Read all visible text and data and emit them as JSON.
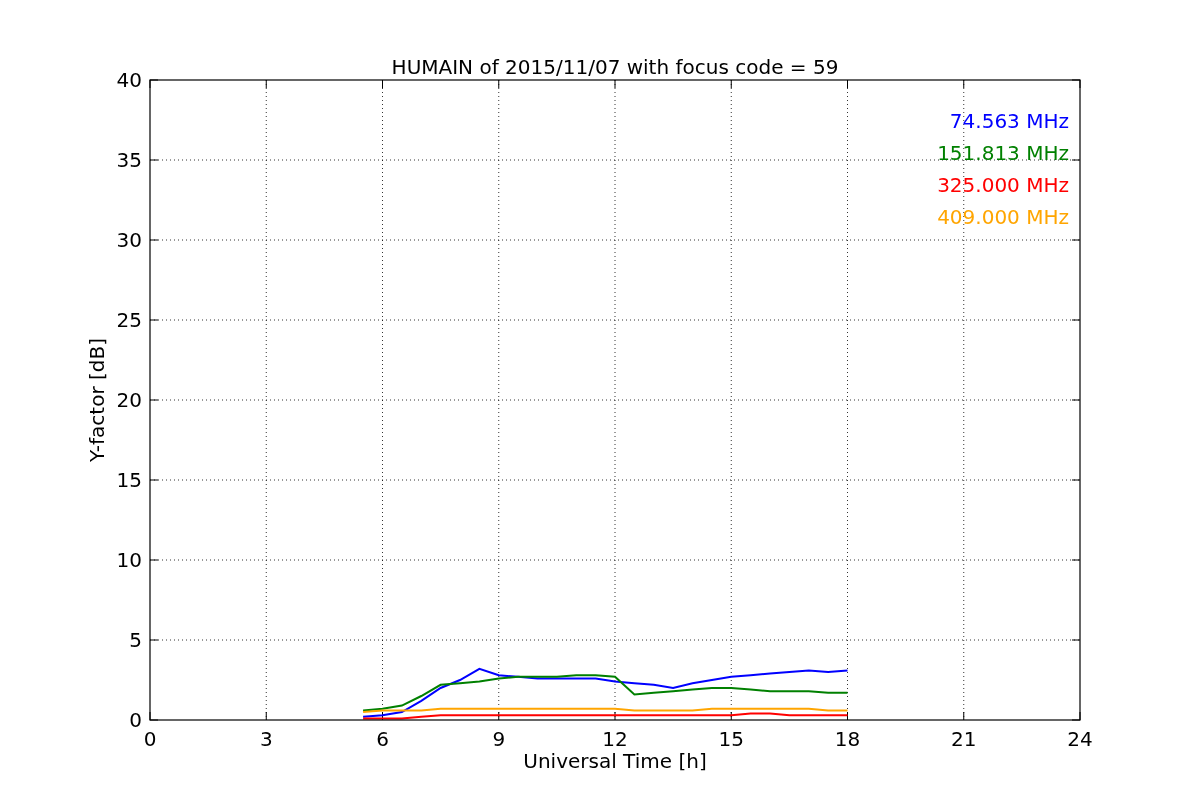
{
  "chart_data": {
    "type": "line",
    "title": "HUMAIN of 2015/11/07 with focus code = 59",
    "xlabel": "Universal Time [h]",
    "ylabel": "Y-factor [dB]",
    "x": [
      5.5,
      6,
      6.5,
      7,
      7.5,
      8,
      8.5,
      9,
      9.5,
      10,
      10.5,
      11,
      11.5,
      12,
      12.5,
      13,
      13.5,
      14,
      14.5,
      15,
      15.5,
      16,
      16.5,
      17,
      17.5,
      18
    ],
    "series": [
      {
        "name": "74.563 MHz",
        "color": "#0000ff",
        "values": [
          0.2,
          0.3,
          0.5,
          1.2,
          2.0,
          2.5,
          3.2,
          2.8,
          2.7,
          2.6,
          2.6,
          2.6,
          2.6,
          2.4,
          2.3,
          2.2,
          2.0,
          2.3,
          2.5,
          2.7,
          2.8,
          2.9,
          3.0,
          3.1,
          3.0,
          3.1
        ]
      },
      {
        "name": "151.813 MHz",
        "color": "#008000",
        "values": [
          0.6,
          0.7,
          0.9,
          1.5,
          2.2,
          2.3,
          2.4,
          2.6,
          2.7,
          2.7,
          2.7,
          2.8,
          2.8,
          2.7,
          1.6,
          1.7,
          1.8,
          1.9,
          2.0,
          2.0,
          1.9,
          1.8,
          1.8,
          1.8,
          1.7,
          1.7
        ]
      },
      {
        "name": "325.000 MHz",
        "color": "#ff0000",
        "values": [
          0.1,
          0.1,
          0.1,
          0.2,
          0.3,
          0.3,
          0.3,
          0.3,
          0.3,
          0.3,
          0.3,
          0.3,
          0.3,
          0.3,
          0.3,
          0.3,
          0.3,
          0.3,
          0.3,
          0.3,
          0.4,
          0.4,
          0.3,
          0.3,
          0.3,
          0.3
        ]
      },
      {
        "name": "409.000 MHz",
        "color": "#ffa500",
        "values": [
          0.5,
          0.6,
          0.6,
          0.6,
          0.7,
          0.7,
          0.7,
          0.7,
          0.7,
          0.7,
          0.7,
          0.7,
          0.7,
          0.7,
          0.6,
          0.6,
          0.6,
          0.6,
          0.7,
          0.7,
          0.7,
          0.7,
          0.7,
          0.7,
          0.6,
          0.6
        ]
      }
    ],
    "grid": true,
    "xlim": [
      0,
      24
    ],
    "ylim": [
      0,
      40
    ],
    "xticks": [
      0,
      3,
      6,
      9,
      12,
      15,
      18,
      21,
      24
    ],
    "yticks": [
      0,
      5,
      10,
      15,
      20,
      25,
      30,
      35,
      40
    ]
  }
}
